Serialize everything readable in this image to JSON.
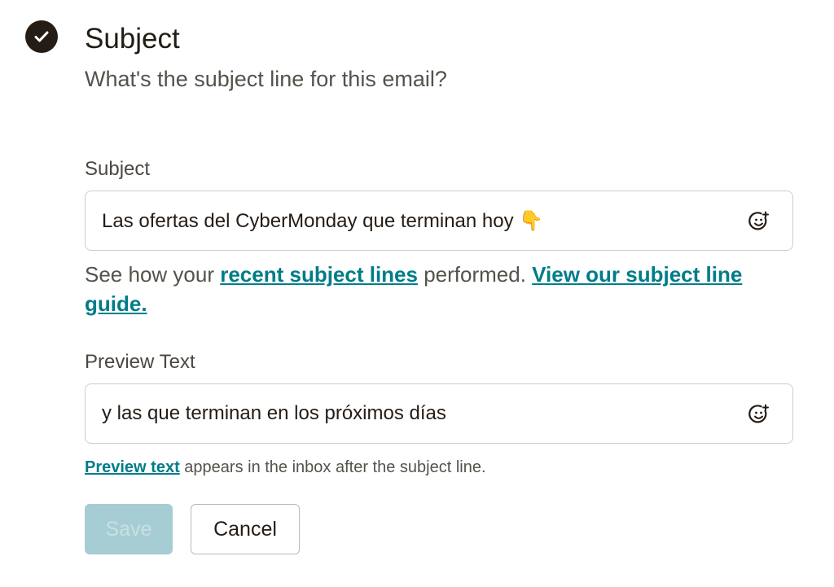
{
  "section": {
    "title": "Subject",
    "subtitle": "What's the subject line for this email?"
  },
  "subject_field": {
    "label": "Subject",
    "value": "Las ofertas del CyberMonday que terminan hoy 👇"
  },
  "subject_help": {
    "prefix": "See how your ",
    "recent_link": "recent subject lines",
    "middle": " performed. ",
    "guide_link": "View our subject line guide."
  },
  "preview_field": {
    "label": "Preview Text",
    "value": "y las que terminan en los próximos días"
  },
  "preview_help": {
    "link": "Preview text",
    "suffix": " appears in the inbox after the subject line."
  },
  "actions": {
    "save_label": "Save",
    "cancel_label": "Cancel"
  },
  "icons": {
    "status": "check-circle-icon",
    "emoji_picker": "emoji-add-icon"
  },
  "colors": {
    "link": "#007c89",
    "save_disabled_bg": "#a6cdd3",
    "badge": "#241c15"
  }
}
